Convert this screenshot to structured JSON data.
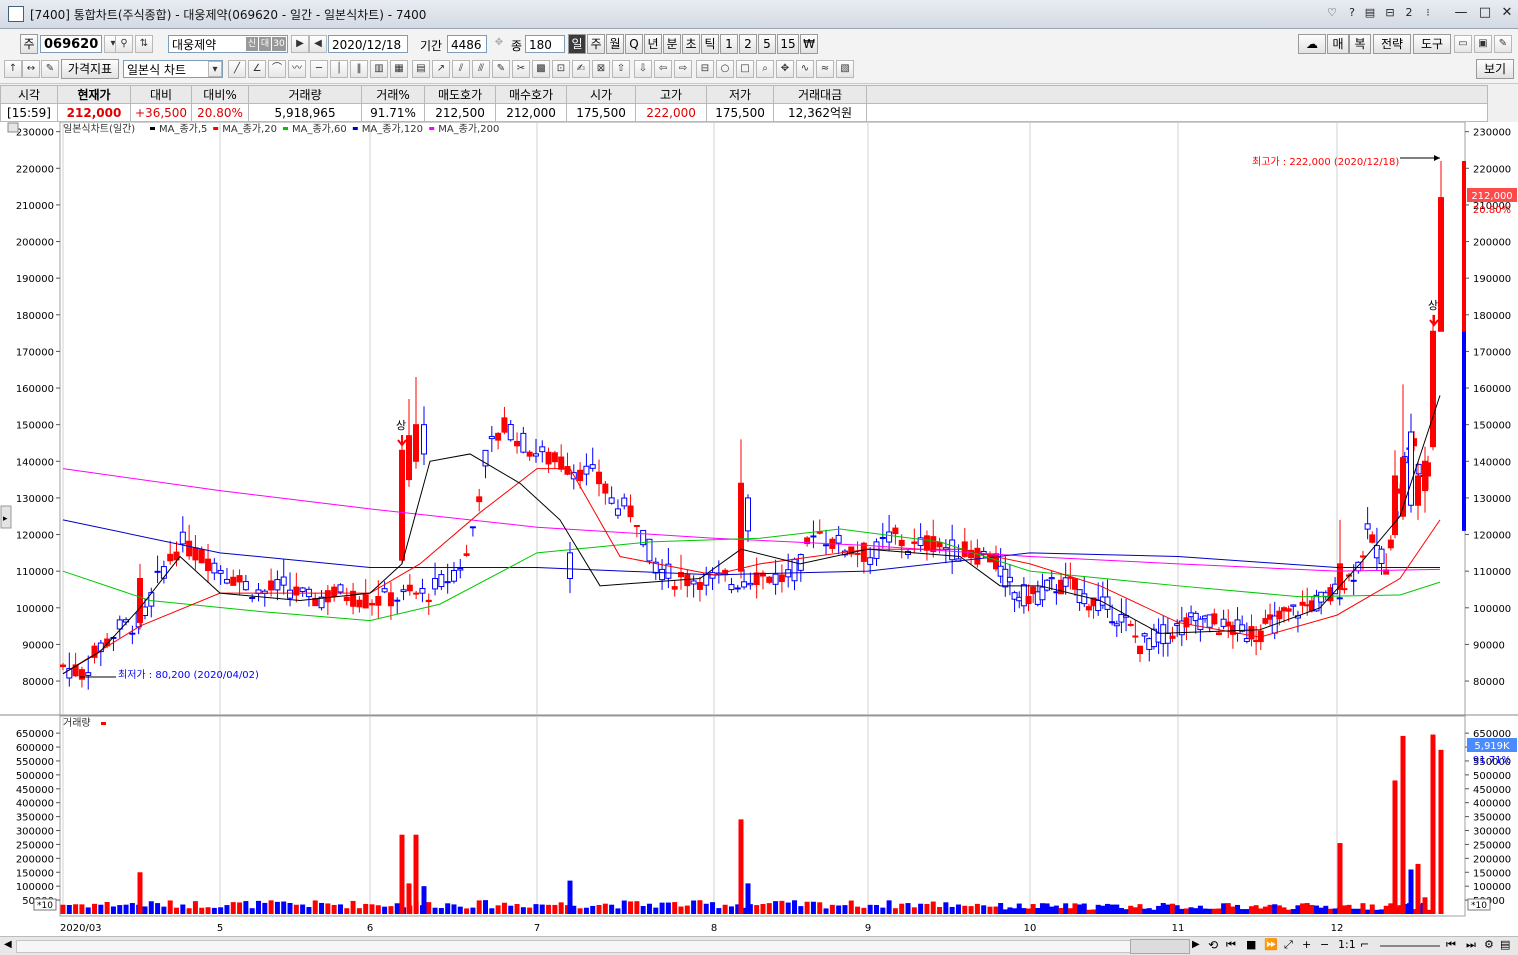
{
  "window": {
    "title": "[7400] 통합차트(주식종합) - 대웅제약(069620 - 일간 - 일본식차트) - 7400"
  },
  "toolbar1": {
    "code_prefix": "주",
    "code": "069620",
    "name": "대웅제약",
    "badges": [
      "신",
      "대",
      "30"
    ],
    "date": "2020/12/18",
    "period_label": "기간",
    "period_value": "4486",
    "count_label": "종",
    "count_value": "180",
    "intervals": [
      "일",
      "주",
      "월",
      "Q",
      "년",
      "분",
      "초",
      "틱",
      "1",
      "2",
      "5",
      "15",
      "₩"
    ],
    "selected_interval": "일",
    "right_buttons": [
      "매",
      "복",
      "전략",
      "도구"
    ]
  },
  "toolbar2": {
    "indicator_label": "가격지표",
    "chart_type": "일본식 차트",
    "view_button": "보기"
  },
  "price_table": {
    "headers": [
      "시각",
      "현재가",
      "대비",
      "대비%",
      "거래량",
      "거래%",
      "매도호가",
      "매수호가",
      "시가",
      "고가",
      "저가",
      "거래대금"
    ],
    "values": [
      "[15:59]",
      "212,000",
      "+36,500",
      "20.80%",
      "5,918,965",
      "91.71%",
      "212,500",
      "212,000",
      "175,500",
      "222,000",
      "175,500",
      "12,362억원"
    ]
  },
  "chart_data": {
    "type": "candlestick",
    "legend": {
      "title": "일본식차트(일간)",
      "items": [
        {
          "name": "MA_종가,5",
          "color": "#000000"
        },
        {
          "name": "MA_종가,20",
          "color": "#ff0000"
        },
        {
          "name": "MA_종가,60",
          "color": "#00c800"
        },
        {
          "name": "MA_종가,120",
          "color": "#0000c8"
        },
        {
          "name": "MA_종가,200",
          "color": "#ff00ff"
        }
      ]
    },
    "y_ticks": [
      230000,
      220000,
      210000,
      200000,
      190000,
      180000,
      170000,
      160000,
      150000,
      140000,
      130000,
      120000,
      110000,
      100000,
      90000,
      80000
    ],
    "ylim": [
      71000,
      231000
    ],
    "x_labels": [
      "2020/03",
      "5",
      "6",
      "7",
      "8",
      "9",
      "10",
      "11",
      "12"
    ],
    "annotations": {
      "high": "최고가 : 222,000 (2020/12/18)",
      "low": "최저가 : 80,200 (2020/04/02)",
      "upper_limit_marks": [
        "상",
        "상"
      ],
      "current_price": "212,000",
      "current_change": "20.80%"
    },
    "candles_sample": [
      {
        "date": "2020/03",
        "open": 84000,
        "high": 86000,
        "low": 82000,
        "close": 83500
      },
      {
        "date": "6",
        "open": 113000,
        "high": 147000,
        "low": 112000,
        "close": 143000
      },
      {
        "date": "12/17",
        "open": 144000,
        "high": 180000,
        "low": 143000,
        "close": 175500
      },
      {
        "date": "12/18",
        "open": 175500,
        "high": 222000,
        "low": 175500,
        "close": 212000
      }
    ],
    "volume": {
      "label": "거래량",
      "y_ticks": [
        650000,
        600000,
        550000,
        500000,
        450000,
        400000,
        350000,
        300000,
        250000,
        200000,
        150000,
        100000,
        50000
      ],
      "unit": "*10",
      "current": "5,919K",
      "current_pct": "91.71%"
    },
    "colors": {
      "up": "#ff0000",
      "down": "#0000ff",
      "grid": "#d0d0d0"
    }
  },
  "bottom_bar": {
    "zoom": "1:1"
  }
}
